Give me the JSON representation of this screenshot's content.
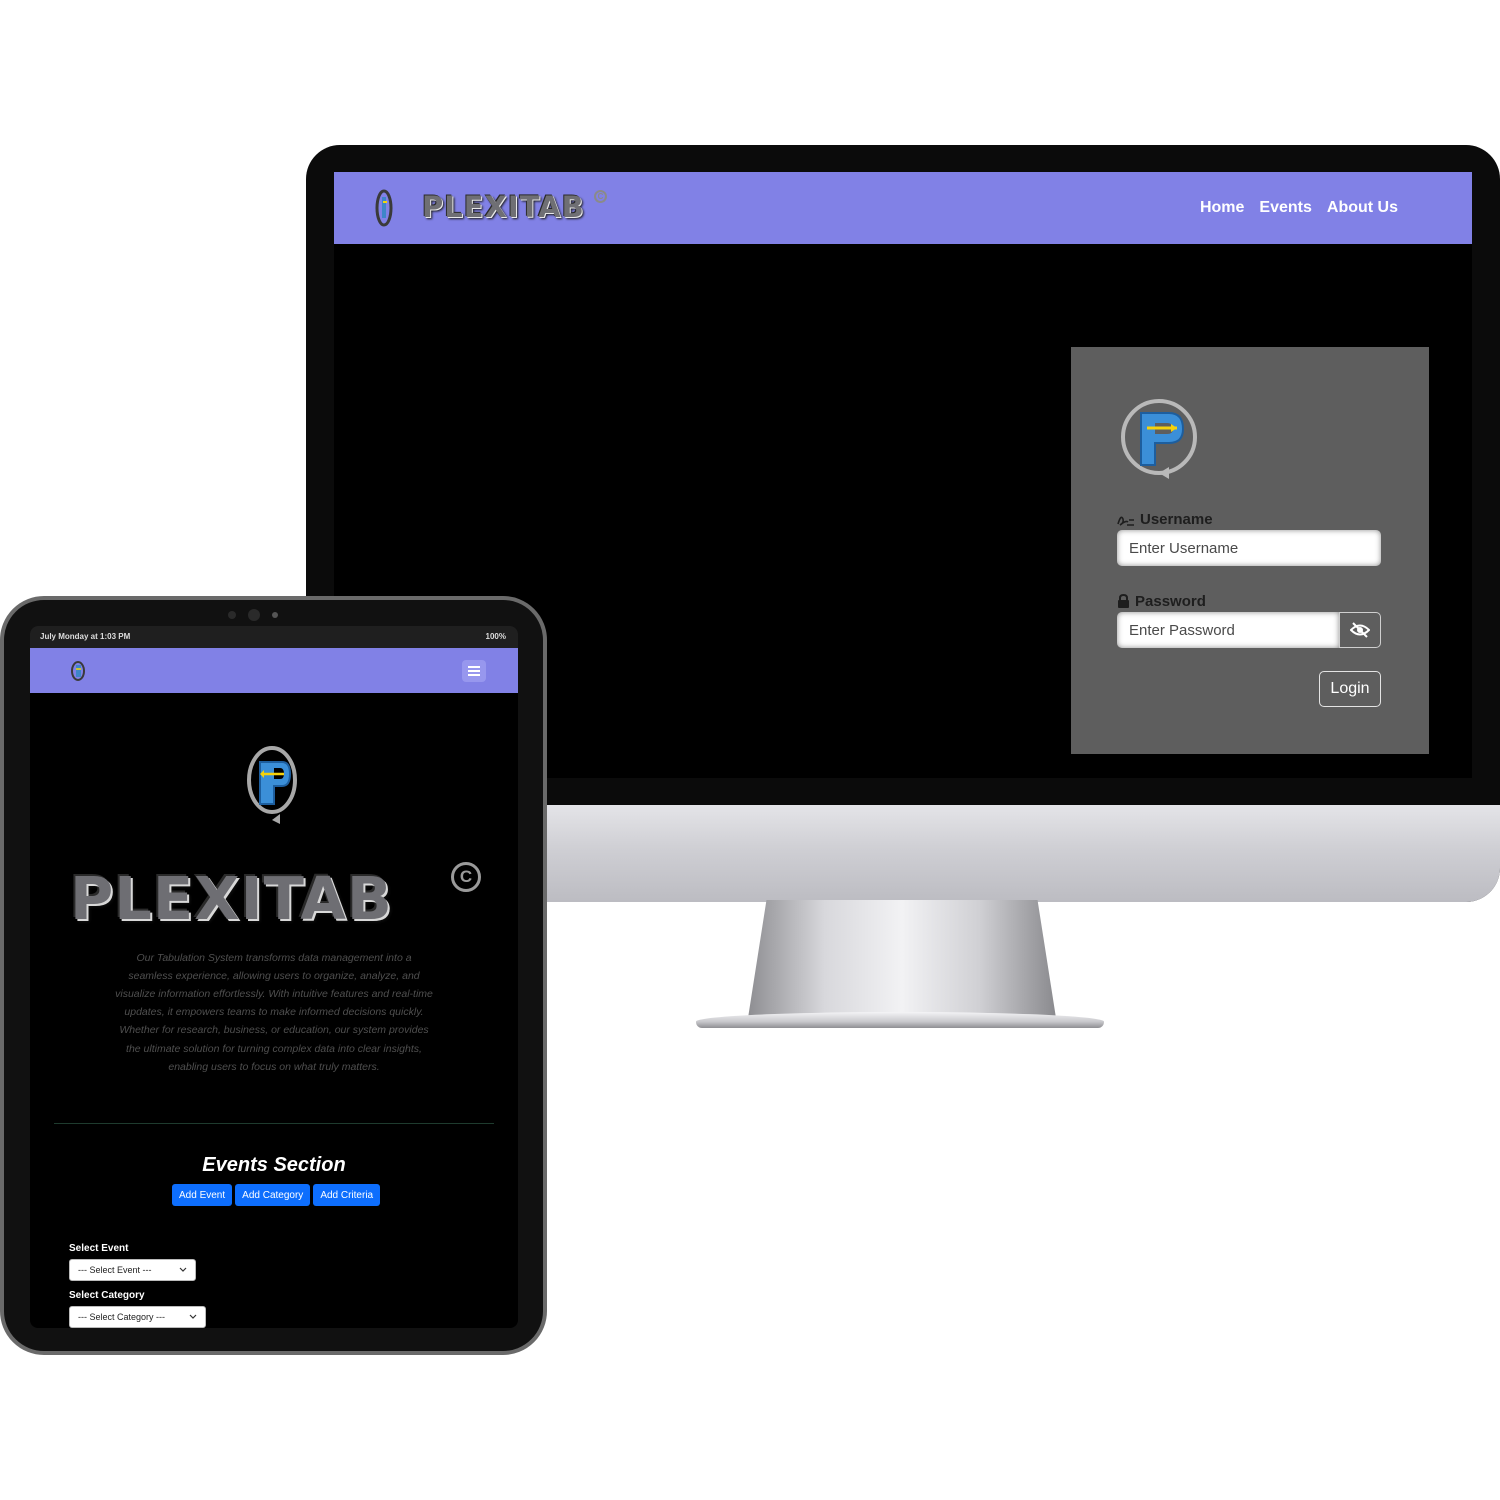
{
  "desktop": {
    "brand": "PLEXITAB",
    "brand_mark": "C",
    "nav": [
      "Home",
      "Events",
      "About Us"
    ],
    "login": {
      "username_label": "Username",
      "username_placeholder": "Enter Username",
      "password_label": "Password",
      "password_placeholder": "Enter Password",
      "toggle_icon": "eye-slash-icon",
      "login_label": "Login"
    }
  },
  "tablet": {
    "status_left": "July Monday at 1:03 PM",
    "status_right": "100%",
    "menu_icon": "hamburger-icon",
    "brand": "PLEXITAB",
    "brand_mark": "C",
    "description": "Our Tabulation System transforms data management into a seamless experience, allowing users to organize, analyze, and visualize information effortlessly. With intuitive features and real-time updates, it empowers teams to make informed decisions quickly. Whether for research, business, or education, our system provides the ultimate solution for turning complex data into clear insights, enabling users to focus on what truly matters.",
    "events_title": "Events Section",
    "buttons": [
      "Add Event",
      "Add Category",
      "Add Criteria"
    ],
    "select_event_label": "Select Event",
    "select_event_value": "--- Select Event ---",
    "select_category_label": "Select Category",
    "select_category_value": "--- Select Category ---"
  },
  "colors": {
    "nav_bg": "#8181e6",
    "card_bg": "#5e5e5e",
    "button_primary": "#0d6efd"
  }
}
